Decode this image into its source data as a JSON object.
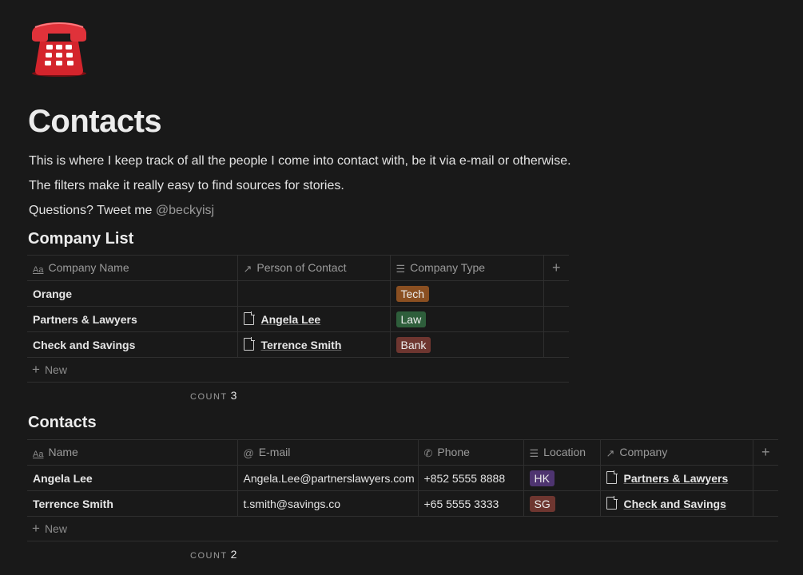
{
  "page": {
    "icon": "telephone-icon",
    "title": "Contacts",
    "paragraphs": [
      "This is where I keep track of all the people I come into contact with, be it via e-mail or otherwise.",
      "The filters make it really easy to find sources for stories."
    ],
    "questions_prefix": "Questions? Tweet me ",
    "mention": "@beckyisj"
  },
  "company_list": {
    "title": "Company List",
    "columns": [
      {
        "label": "Company Name",
        "icon": "title-aa-icon"
      },
      {
        "label": "Person of Contact",
        "icon": "relation-arrow-icon"
      },
      {
        "label": "Company Type",
        "icon": "list-icon"
      }
    ],
    "rows": [
      {
        "name": "Orange",
        "person": "",
        "type": "Tech",
        "type_color": "#8a4f21"
      },
      {
        "name": "Partners & Lawyers",
        "person": "Angela Lee",
        "type": "Law",
        "type_color": "#2e5e3b"
      },
      {
        "name": "Check and Savings",
        "person": "Terrence Smith",
        "type": "Bank",
        "type_color": "#6e3630"
      }
    ],
    "new_label": "New",
    "count_label": "COUNT",
    "count_value": "3"
  },
  "contacts": {
    "title": "Contacts",
    "columns": [
      {
        "label": "Name",
        "icon": "title-aa-icon"
      },
      {
        "label": "E-mail",
        "icon": "at-icon"
      },
      {
        "label": "Phone",
        "icon": "phone-icon"
      },
      {
        "label": "Location",
        "icon": "list-icon"
      },
      {
        "label": "Company",
        "icon": "relation-arrow-icon"
      }
    ],
    "rows": [
      {
        "name": "Angela Lee",
        "email": "Angela.Lee@partnerslawyers.com",
        "phone": "+852 5555 8888",
        "location": "HK",
        "location_color": "#4e3470",
        "company": "Partners & Lawyers"
      },
      {
        "name": "Terrence Smith",
        "email": "t.smith@savings.co",
        "phone": "+65 5555 3333",
        "location": "SG",
        "location_color": "#6e3630",
        "company": "Check and Savings"
      }
    ],
    "new_label": "New",
    "count_label": "COUNT",
    "count_value": "2"
  },
  "colors": {
    "background": "#191919",
    "text": "#e6e6e6",
    "muted": "#9b9b9b",
    "border": "#2f2f2f"
  }
}
